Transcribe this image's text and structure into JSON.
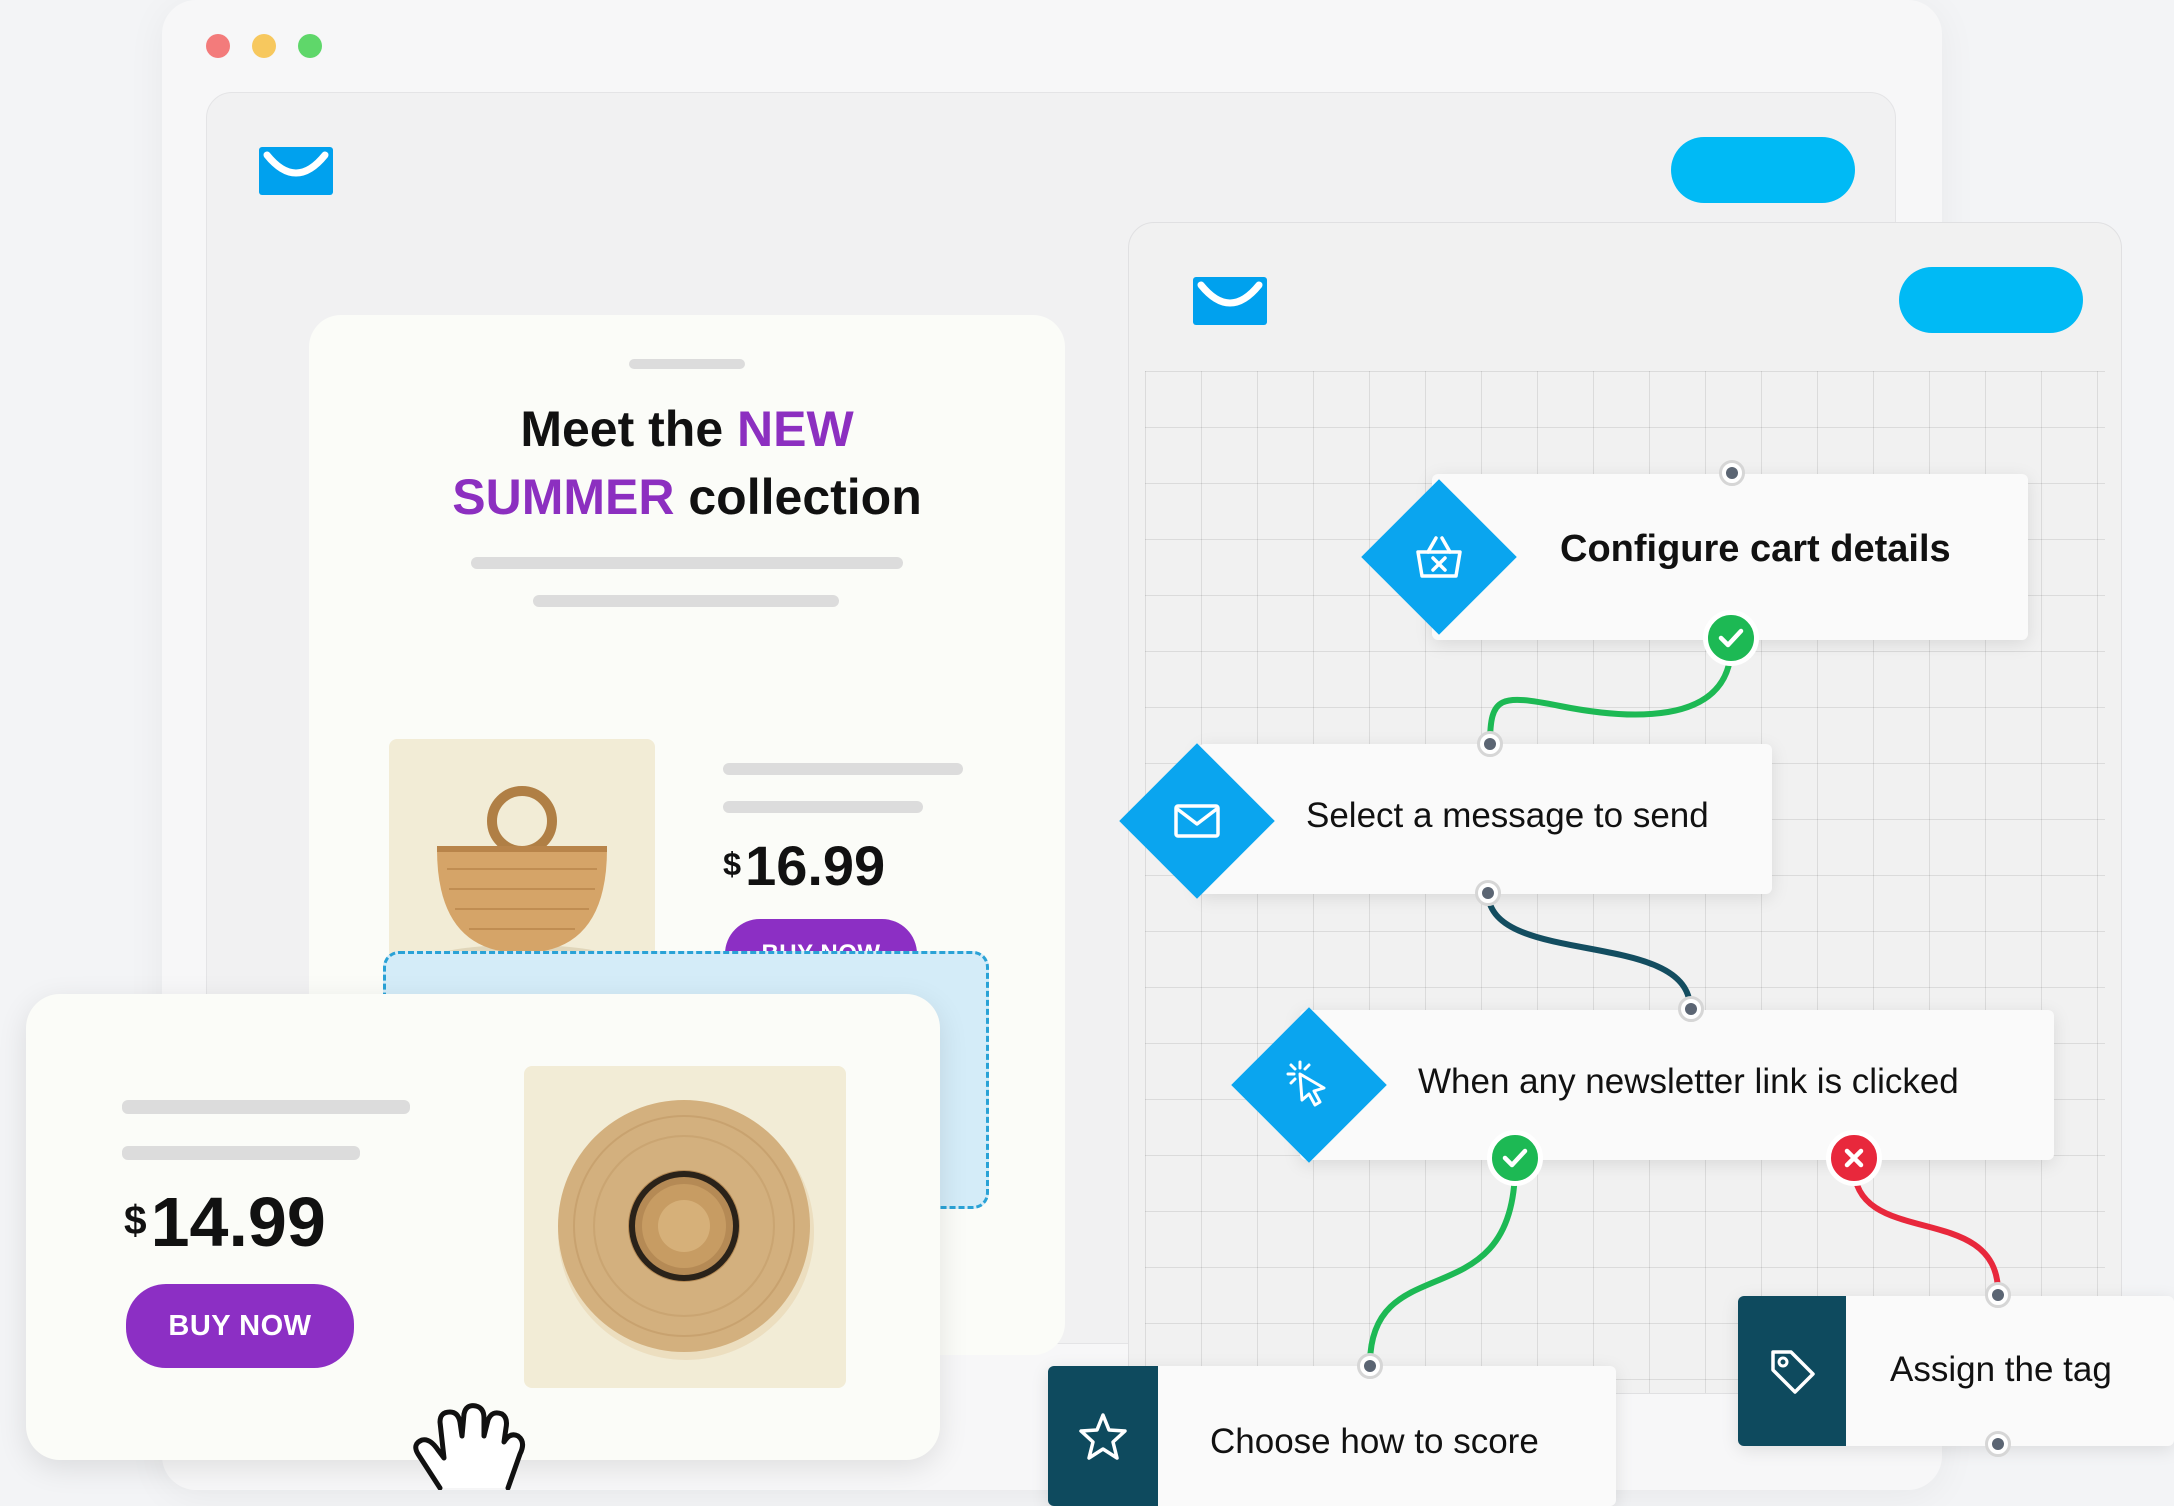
{
  "email_builder": {
    "headline": {
      "part1": "Meet the",
      "highlight1": "NEW",
      "highlight2": "SUMMER",
      "part2": "collection"
    },
    "product": {
      "currency": "$",
      "price": "16.99",
      "button": "BUY NOW",
      "image_icon": "woven-basket-bag"
    }
  },
  "overlay_product": {
    "currency": "$",
    "price": "14.99",
    "button": "BUY NOW",
    "image_icon": "straw-hat"
  },
  "automation": {
    "nodes": [
      {
        "label": "Configure cart details",
        "icon": "basket-icon"
      },
      {
        "label": "Select a message to send",
        "icon": "envelope-icon"
      },
      {
        "label": "When any newsletter link is clicked",
        "icon": "click-cursor-icon"
      },
      {
        "label": "Choose how to score",
        "icon": "star-icon"
      },
      {
        "label": "Assign the tag",
        "icon": "tag-icon"
      }
    ]
  },
  "colors": {
    "brand_blue": "#00a1ee",
    "accent_purple": "#8c2fc4",
    "success_green": "#1db954",
    "error_red": "#e8283c",
    "dark_teal": "#0e4a5e"
  }
}
